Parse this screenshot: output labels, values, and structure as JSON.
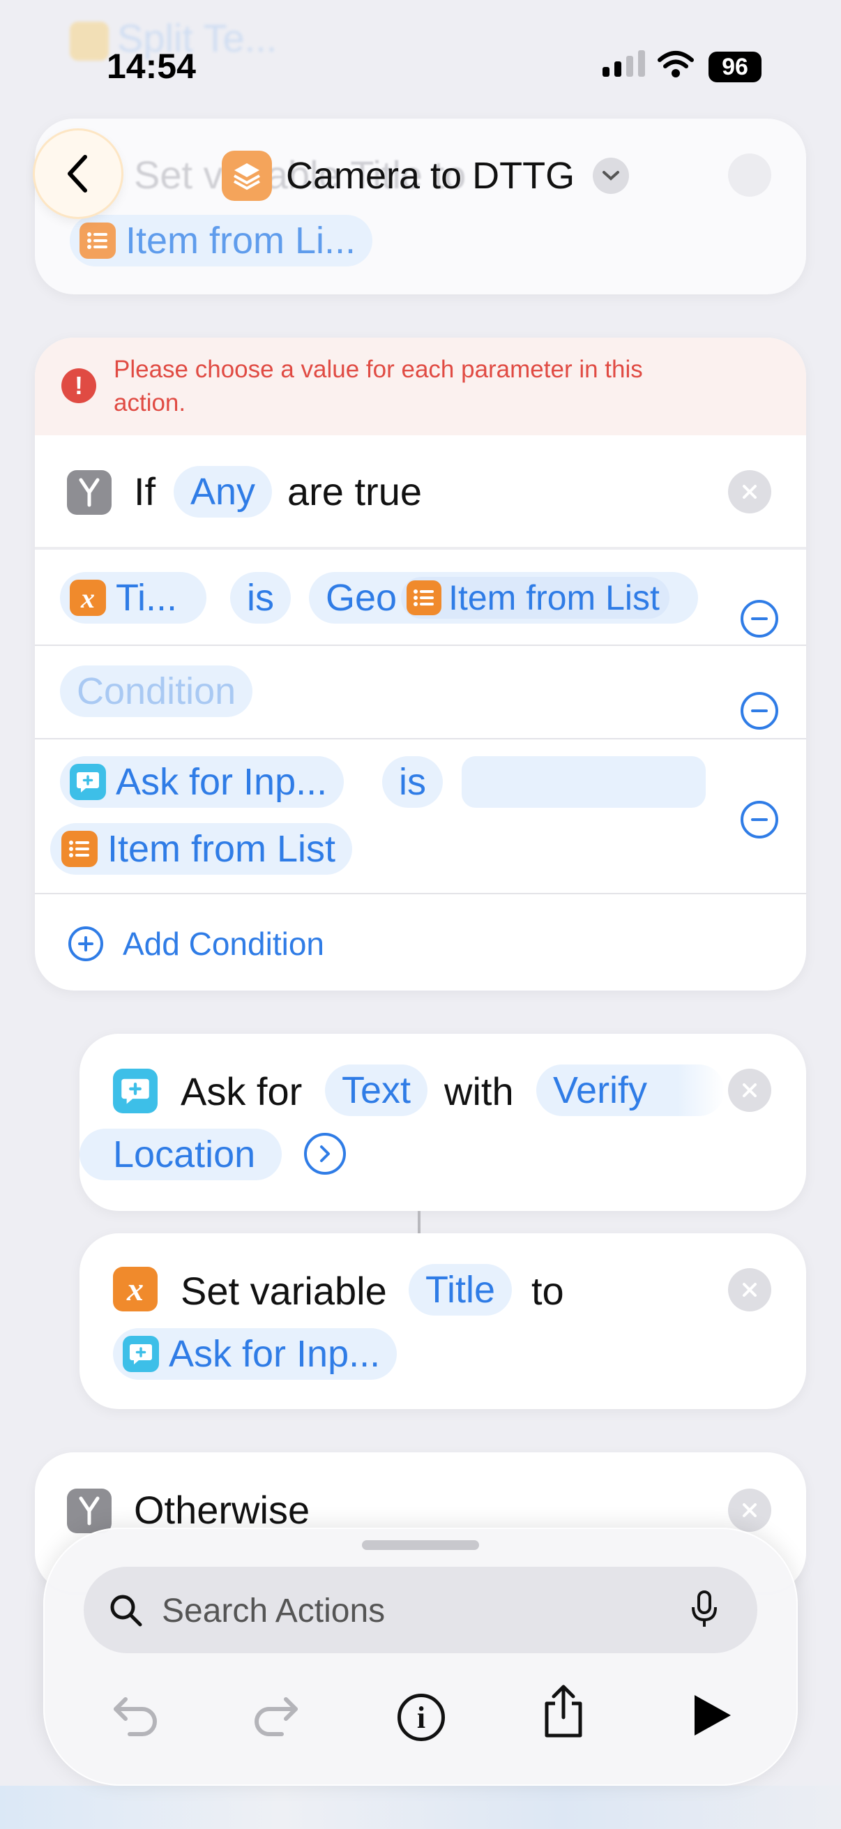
{
  "status_bar": {
    "time": "14:54",
    "battery": "96"
  },
  "ghost_top": {
    "text": "Split Te..."
  },
  "header": {
    "title": "Camera to DTTG"
  },
  "prev_card": {
    "ghost_text": "Set variable Title to",
    "item_pill": "Item from Li..."
  },
  "if_card": {
    "error": "Please choose a value for each parameter in this action.",
    "if_label": "If",
    "any_pill": "Any",
    "are_true": "are true",
    "row1": {
      "var_pill": "Ti...",
      "is_pill": "is",
      "geo_text": "Geo",
      "item_pill": "Item from List"
    },
    "row2": {
      "condition_placeholder": "Condition"
    },
    "row3": {
      "ask_pill": "Ask for Inp...",
      "is_pill": "is",
      "item_pill": "Item from List"
    },
    "add_condition": "Add Condition"
  },
  "ask_card": {
    "ask_for": "Ask for",
    "text_pill": "Text",
    "with": "with",
    "prompt_line1": "Verify",
    "prompt_line2": "Location"
  },
  "setvar_card": {
    "label": "Set variable",
    "var_pill": "Title",
    "to": "to",
    "ask_pill": "Ask for Inp..."
  },
  "otherwise_card": {
    "label": "Otherwise"
  },
  "bottom_bar": {
    "search_placeholder": "Search Actions"
  },
  "colors": {
    "accent": "#2f7ce6",
    "orange": "#f08a2c",
    "cyan": "#3dbfe8",
    "gray_icon": "#8e8e93",
    "error_red": "#e04b43",
    "error_bg": "#fbf1ef"
  },
  "icons": [
    "back-chevron-icon",
    "shortcut-stack-icon",
    "chevron-down-icon",
    "alert-icon",
    "if-branch-icon",
    "close-icon",
    "variable-x-icon",
    "list-icon",
    "ask-input-icon",
    "minus-circle-icon",
    "plus-circle-icon",
    "arrow-right-circle-icon",
    "search-icon",
    "mic-icon",
    "undo-icon",
    "redo-icon",
    "info-icon",
    "share-icon",
    "play-icon"
  ]
}
